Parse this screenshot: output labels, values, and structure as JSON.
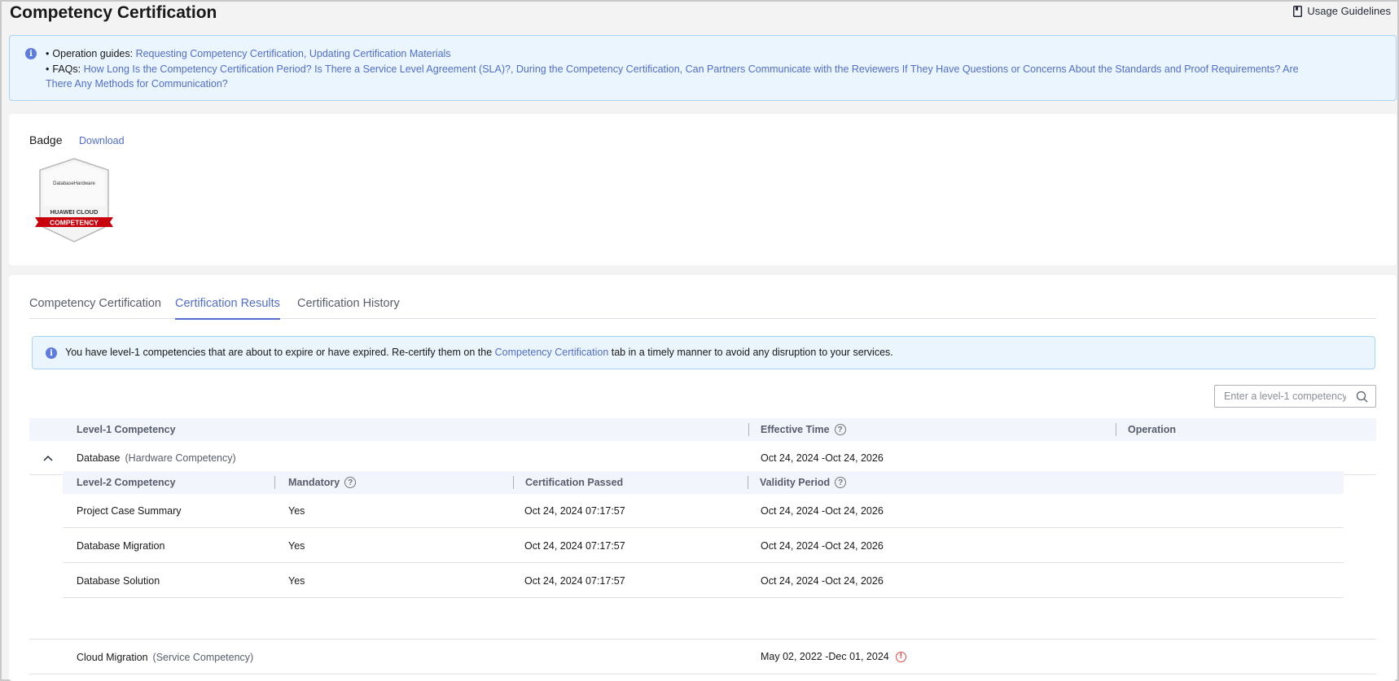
{
  "header": {
    "title": "Competency Certification",
    "usage_guidelines": "Usage Guidelines"
  },
  "guides": {
    "operation_prefix": "Operation guides:",
    "operation_links": "Requesting Competency Certification, Updating Certification Materials",
    "faq_prefix": "FAQs:",
    "faq_links": "How Long Is the Competency Certification Period? Is There a Service Level Agreement (SLA)?, During the Competency Certification, Can Partners Communicate with the Reviewers If They Have Questions or Concerns About the Standards and Proof Requirements? Are There Any Methods for Communication?"
  },
  "badge": {
    "label": "Badge",
    "download": "Download",
    "image_text_top": "DatabaseHardware",
    "image_text_brand": "HUAWEI CLOUD",
    "image_text_ribbon": "COMPETENCY"
  },
  "tabs": {
    "tab1": "Competency Certification",
    "tab2": "Certification Results",
    "tab3": "Certification History"
  },
  "notice": {
    "before": "You have level-1 competencies that are about to expire or have expired. Re-certify them on the ",
    "link": "Competency Certification",
    "after": " tab in a timely manner to avoid any disruption to your services."
  },
  "search": {
    "placeholder": "Enter a level-1 competency"
  },
  "table": {
    "col_level1": "Level-1 Competency",
    "col_effective": "Effective Time",
    "col_operation": "Operation",
    "rows": [
      {
        "name": "Database",
        "type": "(Hardware Competency)",
        "effective": "Oct 24, 2024 -Oct 24, 2026"
      },
      {
        "name": "Cloud Migration",
        "type": "(Service Competency)",
        "effective": "May 02, 2022 -Dec 01, 2024"
      }
    ]
  },
  "subtable": {
    "col_level2": "Level-2 Competency",
    "col_mandatory": "Mandatory",
    "col_passed": "Certification Passed",
    "col_validity": "Validity Period",
    "rows": [
      {
        "name": "Project Case Summary",
        "mandatory": "Yes",
        "passed": "Oct 24, 2024 07:17:57",
        "validity": "Oct 24, 2024 -Oct 24, 2026"
      },
      {
        "name": "Database Migration",
        "mandatory": "Yes",
        "passed": "Oct 24, 2024 07:17:57",
        "validity": "Oct 24, 2024 -Oct 24, 2026"
      },
      {
        "name": "Database Solution",
        "mandatory": "Yes",
        "passed": "Oct 24, 2024 07:17:57",
        "validity": "Oct 24, 2024 -Oct 24, 2026"
      }
    ]
  },
  "colors": {
    "accent": "#526ecc",
    "info_bg": "#eaf5fd",
    "ribbon_red": "#c7000b",
    "warning": "#e54545"
  }
}
